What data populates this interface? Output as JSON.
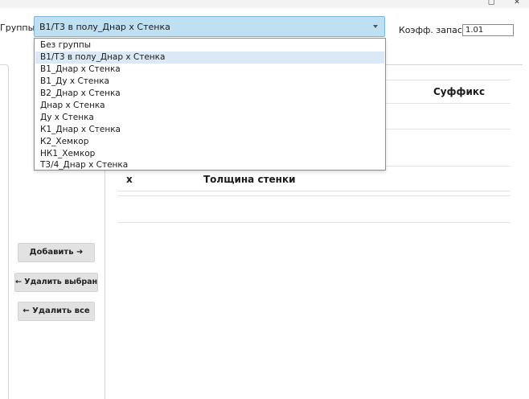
{
  "toolbar": {
    "groups_label": "Группы:",
    "selected_group": "В1/Т3 в полу_Днар х Стенка",
    "coef_label": "Коэфф. запаса:",
    "coef_value": "1.01"
  },
  "dropdown": {
    "options": [
      "Без группы",
      "В1/Т3 в полу_Днар х Стенка",
      "В1_Днар х Стенка",
      "В1_Ду х Стенка",
      "В2_Днар х Стенка",
      "Днар х Стенка",
      "Ду х Стенка",
      "К1_Днар х Стенка",
      "К2_Хемкор",
      "НК1_Хемкор",
      "Т3/4_Днар х Стенка"
    ],
    "selected_index": 1
  },
  "buttons": {
    "add": "Добавить ➜",
    "remove_selected": "← Удалить выбранные",
    "remove_all": "← Удалить все"
  },
  "table": {
    "suffix_header": "Суффикс",
    "x_header": "х",
    "wall_header": "Толщина стенки"
  },
  "colors": {
    "combo_bg": "#bfdff2",
    "selected_option_bg": "#dbe9f7",
    "button_bg": "#e2e2e2"
  }
}
